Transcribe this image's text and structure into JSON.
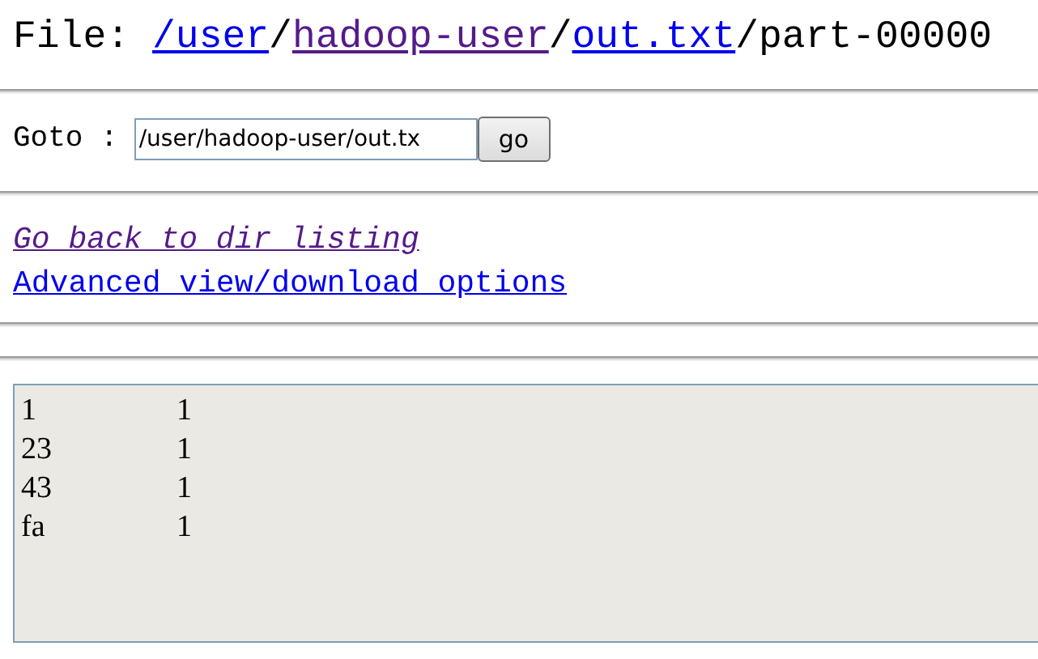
{
  "heading": {
    "label": "File:",
    "parts": [
      {
        "text": "/user",
        "kind": "link",
        "visited": false
      },
      {
        "text": "/",
        "kind": "text"
      },
      {
        "text": "hadoop-user",
        "kind": "link",
        "visited": true
      },
      {
        "text": "/",
        "kind": "text"
      },
      {
        "text": "out.txt",
        "kind": "link",
        "visited": false
      },
      {
        "text": "/part-00000",
        "kind": "text"
      }
    ]
  },
  "goto": {
    "label": "Goto :",
    "value": "/user/hadoop-user/out.tx",
    "button": "go"
  },
  "links": [
    {
      "text": "Go back to dir listing",
      "visited": true,
      "italic": true
    },
    {
      "text": "Advanced view/download options",
      "visited": false,
      "italic": false
    }
  ],
  "content": {
    "rows": [
      [
        "1",
        "1"
      ],
      [
        "23",
        "1"
      ],
      [
        "43",
        "1"
      ],
      [
        "fa",
        "1"
      ]
    ]
  }
}
